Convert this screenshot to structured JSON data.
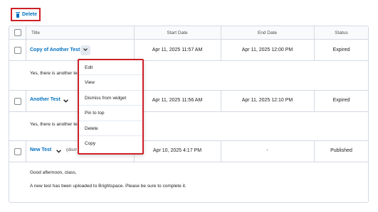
{
  "toolbar": {
    "delete_label": "Delete",
    "delete_icon": "trash-icon"
  },
  "columns": {
    "title": "Title",
    "start": "Start Date",
    "end": "End Date",
    "status": "Status"
  },
  "rows": [
    {
      "title": "Copy of Another Test",
      "start": "Apr 11, 2025 11:57 AM",
      "end": "Apr 11, 2025 12:00 PM",
      "status": "Expired",
      "preview": "Yes, there is another test"
    },
    {
      "title": "Another Test",
      "start": "Apr 11, 2025 11:56 AM",
      "end": "Apr 11, 2025 12:10 PM",
      "status": "Expired",
      "preview": "Yes, there is another test"
    },
    {
      "title": "New Test",
      "dismissed": "(dismissed)",
      "start": "Apr 10, 2025 4:17 PM",
      "end": "-",
      "status": "Published",
      "preview_line1": "Good afternoon, class,",
      "preview_line2": "A new test has been uploaded to Brightspace. Please be sure to complete it."
    }
  ],
  "context_menu": [
    "Edit",
    "View",
    "Dismiss from widget",
    "Pin to top",
    "Delete",
    "Copy"
  ],
  "colors": {
    "link": "#006fbf",
    "highlight": "#cd2026",
    "border": "#d3d9e3",
    "header_bg": "#f9fafb"
  }
}
